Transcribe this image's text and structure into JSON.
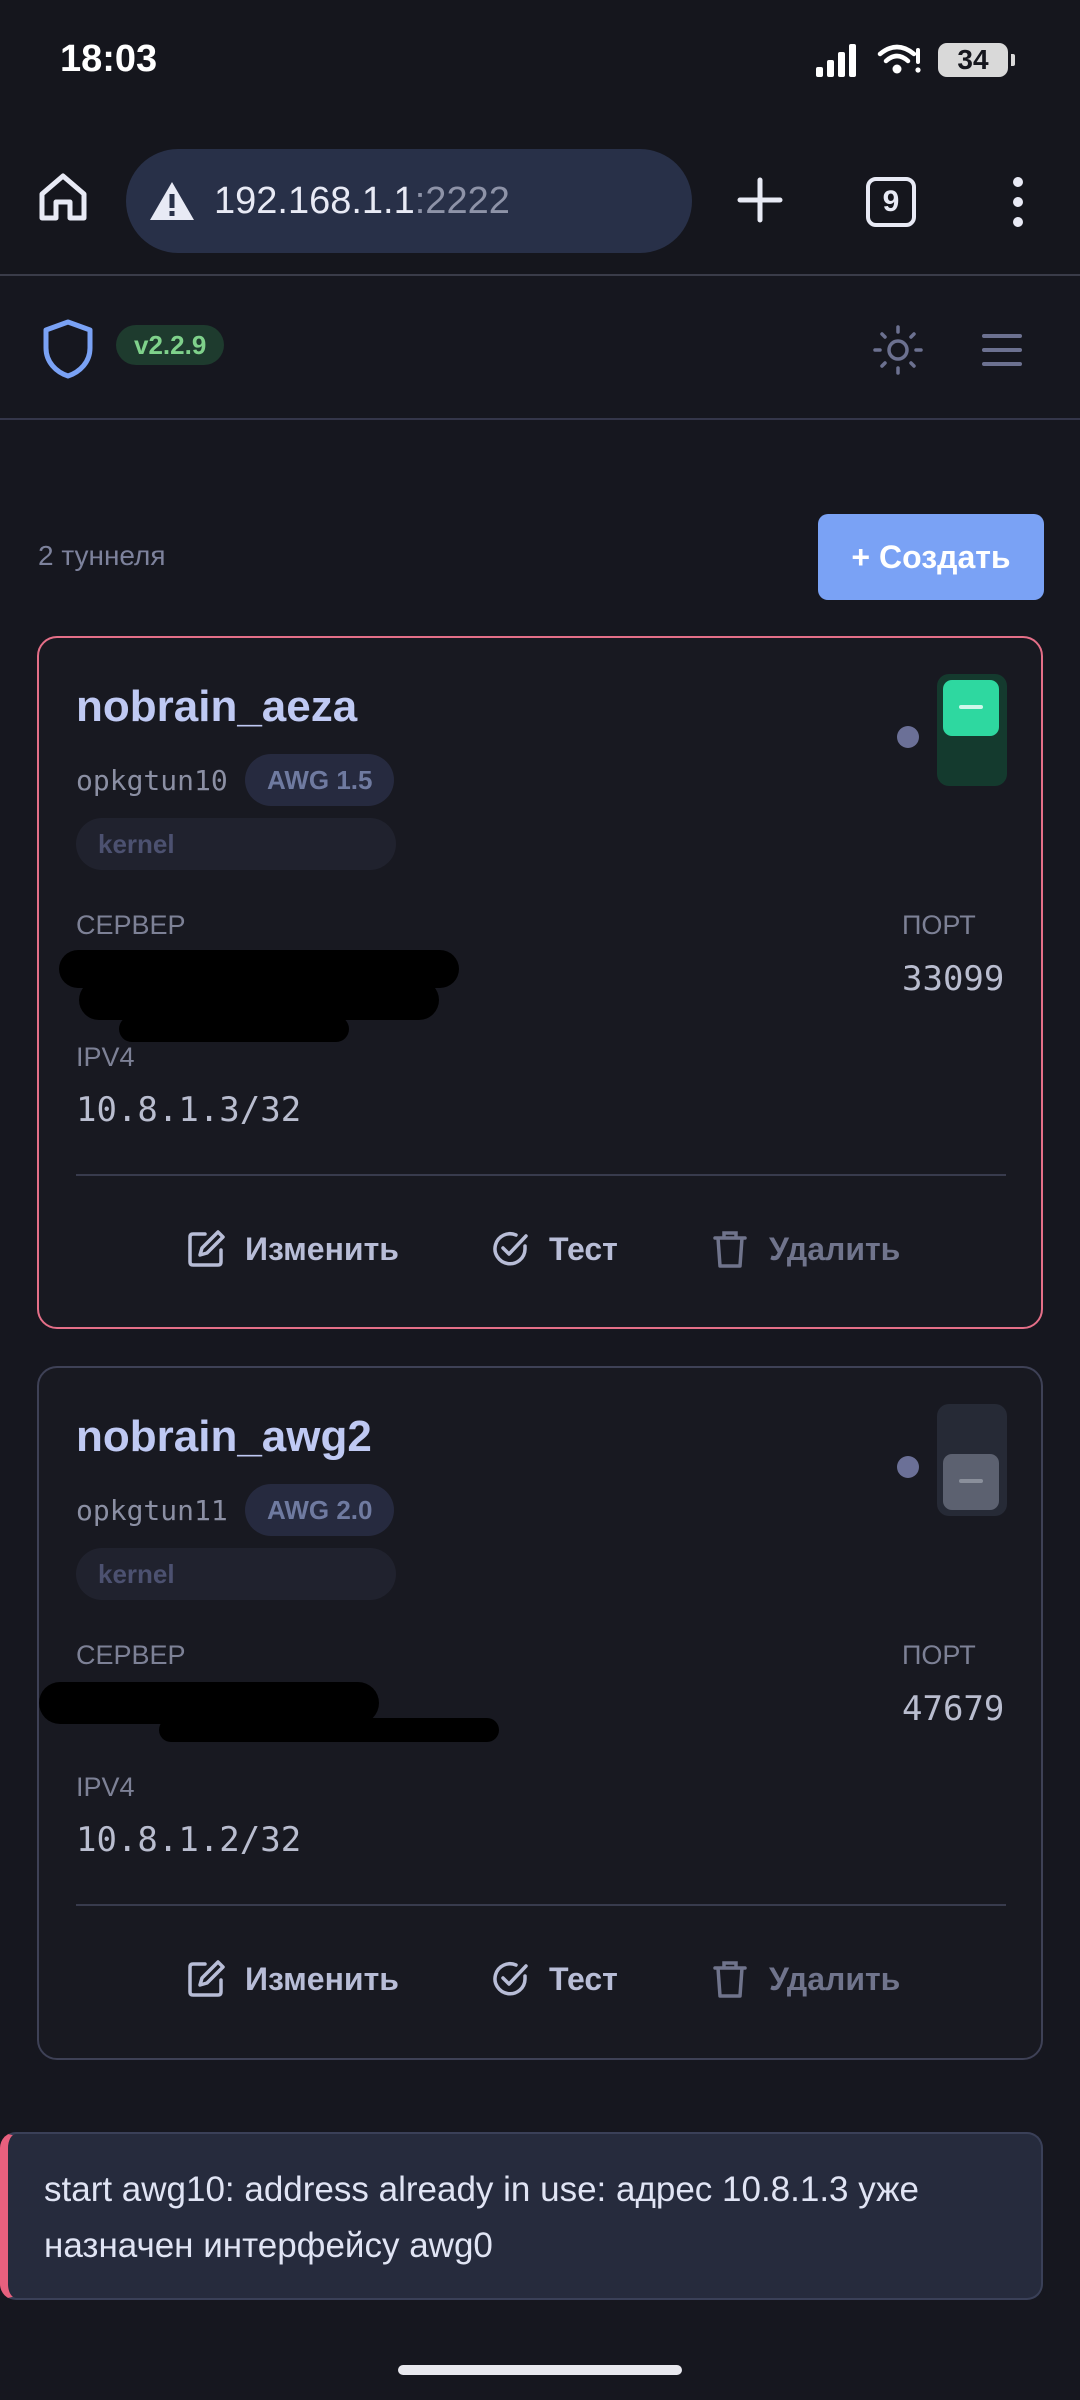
{
  "status_bar": {
    "time": "18:03",
    "battery": "34"
  },
  "browser": {
    "url_host": "192.168.1.1",
    "url_port": ":2222",
    "tab_count": "9"
  },
  "app": {
    "version": "v2.2.9"
  },
  "toolbar": {
    "tunnel_count": "2 туннеля",
    "create_label": "+ Создать"
  },
  "tunnels": [
    {
      "name": "nobrain_aeza",
      "iface": "opkgtun10",
      "awg": "AWG 1.5",
      "backend": "kernel",
      "enabled": true,
      "server_label": "СЕРВЕР",
      "port_label": "ПОРТ",
      "port": "33099",
      "ipv4_label": "IPV4",
      "ipv4": "10.8.1.3/32",
      "actions": {
        "edit": "Изменить",
        "test": "Тест",
        "delete": "Удалить"
      }
    },
    {
      "name": "nobrain_awg2",
      "iface": "opkgtun11",
      "awg": "AWG 2.0",
      "backend": "kernel",
      "enabled": false,
      "server_label": "СЕРВЕР",
      "port_label": "ПОРТ",
      "port": "47679",
      "ipv4_label": "IPV4",
      "ipv4": "10.8.1.2/32",
      "actions": {
        "edit": "Изменить",
        "test": "Тест",
        "delete": "Удалить"
      }
    }
  ],
  "toast": {
    "message": "start awg10: address already in use: адрес 10.8.1.3 уже назначен интерфейсу awg0"
  },
  "colors": {
    "accent": "#7aa2f5",
    "active_border": "#e46f88",
    "toggle_on": "#2ed8a0",
    "version_badge": "#7fd18b"
  }
}
